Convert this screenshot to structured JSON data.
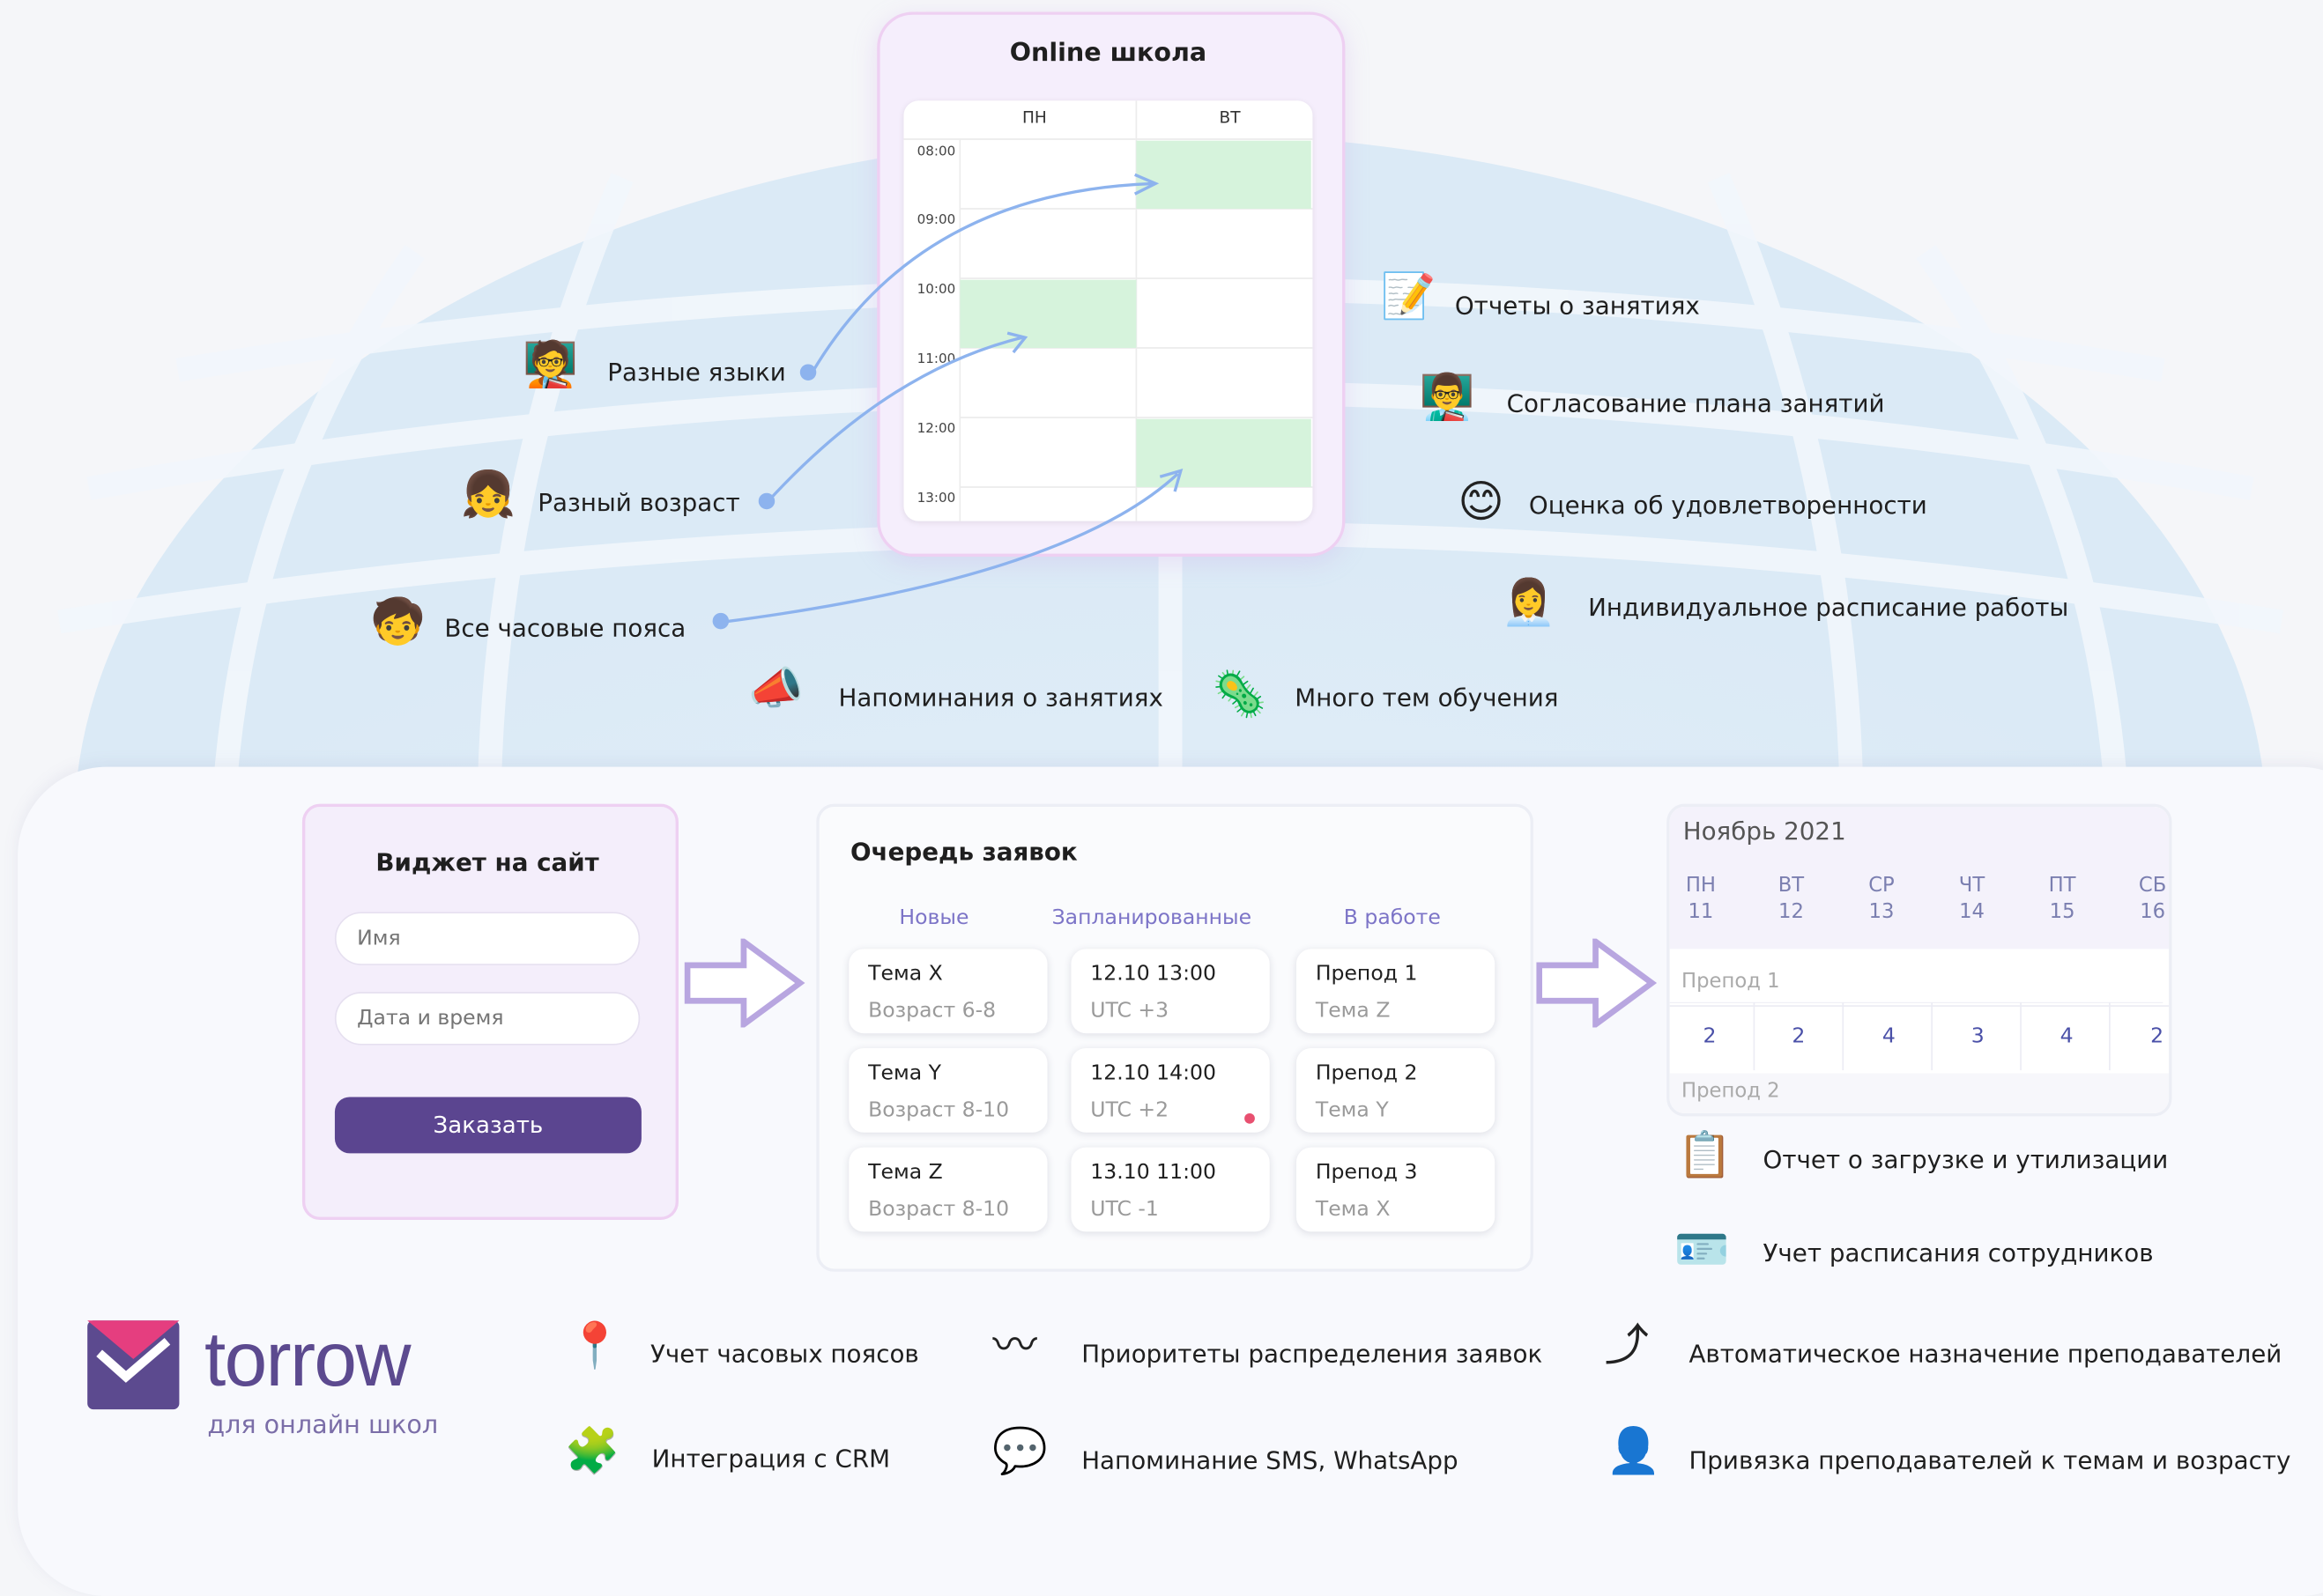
{
  "school": {
    "title": "Online школа",
    "days": [
      "ПН",
      "ВТ"
    ],
    "times": [
      "08:00",
      "09:00",
      "10:00",
      "11:00",
      "12:00",
      "13:00"
    ]
  },
  "left_features": [
    "Разные языки",
    "Разный возраст",
    "Все часовые пояса"
  ],
  "right_features": [
    "Отчеты о занятиях",
    "Согласование плана занятий",
    "Оценка об удовлетворенности",
    "Индивидуальное расписание работы"
  ],
  "bottom_features": [
    "Напоминания о занятиях",
    "Много тем обучения"
  ],
  "widget": {
    "title": "Виджет на сайт",
    "name_placeholder": "Имя",
    "datetime_placeholder": "Дата и время",
    "order_button": "Заказать"
  },
  "queue": {
    "title": "Очередь заявок",
    "columns": [
      "Новые",
      "Запланированные",
      "В работе"
    ],
    "new": [
      {
        "title": "Тема X",
        "sub": "Возраст 6-8"
      },
      {
        "title": "Тема Y",
        "sub": "Возраст 8-10"
      },
      {
        "title": "Тема Z",
        "sub": "Возраст 8-10"
      }
    ],
    "planned": [
      {
        "title": "12.10 13:00",
        "sub": "UTC +3"
      },
      {
        "title": "12.10 14:00",
        "sub": "UTC +2"
      },
      {
        "title": "13.10 11:00",
        "sub": "UTC -1"
      }
    ],
    "in_work": [
      {
        "title": "Препод 1",
        "sub": "Тема Z"
      },
      {
        "title": "Препод 2",
        "sub": "Тема Y"
      },
      {
        "title": "Препод 3",
        "sub": "Тема X"
      }
    ]
  },
  "calendar": {
    "month": "Ноябрь 2021",
    "days": [
      {
        "d": "ПН",
        "n": "11"
      },
      {
        "d": "ВТ",
        "n": "12"
      },
      {
        "d": "СР",
        "n": "13"
      },
      {
        "d": "ЧТ",
        "n": "14"
      },
      {
        "d": "ПТ",
        "n": "15"
      },
      {
        "d": "СБ",
        "n": "16"
      }
    ],
    "row1_label": "Препод 1",
    "counts": [
      "2",
      "2",
      "4",
      "3",
      "4",
      "2"
    ],
    "row2_label": "Препод 2"
  },
  "calendar_features": [
    "Отчет о загрузке и утилизации",
    "Учет расписания сотрудников"
  ],
  "brand": {
    "name": "torrow",
    "tagline": "для онлайн школ"
  },
  "features": [
    "Учет часовых поясов",
    "Приоритеты распределения заявок",
    "Автоматическое назначение преподавателей",
    "Интеграция с CRM",
    "Напоминание SMS, WhatsApp",
    "Привязка преподавателей к темам и возрасту"
  ],
  "colors": {
    "accent": "#5b4590",
    "brand": "#5c4a8f",
    "brand_pink": "#e53e7f",
    "slot_green": "#d6f3dc",
    "panel_lilac": "#f4eefb"
  },
  "icons": [
    "teacher-man-icon",
    "girl-icon",
    "child-icon",
    "notepad-icon",
    "teacher-board-icon",
    "smile-icon",
    "woman-icon",
    "megaphone-icon",
    "virus-icon",
    "clipboard-icon",
    "id-card-icon",
    "pin-icon",
    "soundwave-icon",
    "puzzle-icon",
    "chat-icon",
    "fork-arrow-icon",
    "person-network-icon"
  ]
}
